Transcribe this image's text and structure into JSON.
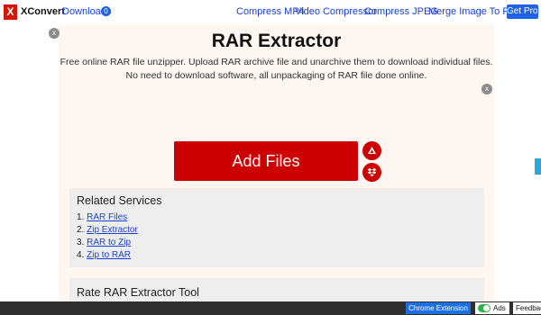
{
  "nav": {
    "logo_letter": "X",
    "brand": "XConvert",
    "downloads_label": "Downloads",
    "downloads_count": "0",
    "links": [
      "Compress MP4",
      "Video Compressor",
      "Compress JPEG",
      "Merge Image To PDF"
    ],
    "cta": "Get Pro!"
  },
  "main": {
    "title": "RAR Extractor",
    "description_line1": "Free online RAR file unzipper. Upload RAR archive file and unarchive them to download individual files.",
    "description_line2": "No need to download software, all unpackaging of RAR file done online.",
    "add_files_label": "Add Files",
    "side_icons": [
      "google-drive-icon",
      "dropbox-icon"
    ],
    "close_label": "x"
  },
  "related": {
    "heading": "Related Services",
    "items": [
      {
        "num": "1.",
        "label": "RAR Files"
      },
      {
        "num": "2.",
        "label": "Zip Extractor"
      },
      {
        "num": "3.",
        "label": "RAR to Zip"
      },
      {
        "num": "4.",
        "label": "Zip to RAR"
      }
    ]
  },
  "rate": {
    "heading": "Rate RAR Extractor Tool"
  },
  "bottom_bar": {
    "chrome_extension": "Chrome Extension",
    "ads_label": "Ads",
    "ads_enabled": true,
    "feedback": "Feedback"
  },
  "colors": {
    "brand_red": "#cc0000",
    "link_blue": "#1a3fd6",
    "cta_blue": "#1f62e6",
    "panel_bg": "#fdf6f1",
    "toggle_green": "#2fb34a"
  }
}
